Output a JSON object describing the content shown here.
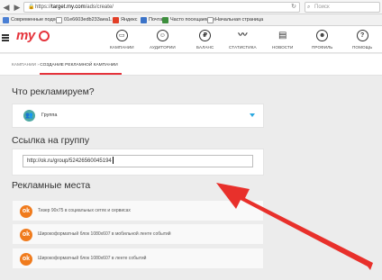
{
  "browser": {
    "address_prefix": "https://",
    "address_host": "target.my.com",
    "address_path": "/ads/create/",
    "search_placeholder": "Поиск",
    "bookmarks": [
      {
        "label": "Современные подхо...",
        "color": "#4a7fd4"
      },
      {
        "label": "01e6603edb233aea1...",
        "color": "#d9d9d9"
      },
      {
        "label": "Яндекс",
        "color": "#e23f27"
      },
      {
        "label": "Почта",
        "color": "#3b73c8"
      },
      {
        "label": "Часто посещаемые",
        "color": "#3d8f3d"
      },
      {
        "label": "Начальная страница",
        "color": "#d9d9d9"
      }
    ]
  },
  "header": {
    "logo_text": "my",
    "nav": [
      {
        "label": "КАМПАНИИ",
        "icon": "megaphone-icon",
        "glyph": "▭"
      },
      {
        "label": "АУДИТОРИИ",
        "icon": "audience-icon",
        "glyph": "☺"
      },
      {
        "label": "БАЛАНС",
        "icon": "ruble-icon",
        "glyph": "₽"
      },
      {
        "label": "СТАТИСТИКА",
        "icon": "chart-icon",
        "glyph": "〰"
      },
      {
        "label": "НОВОСТИ",
        "icon": "news-icon",
        "glyph": "▤"
      },
      {
        "label": "ПРОФИЛЬ",
        "icon": "profile-icon",
        "glyph": "☻"
      },
      {
        "label": "ПОМОЩЬ",
        "icon": "help-icon",
        "glyph": "?"
      }
    ]
  },
  "breadcrumb": {
    "parent": "КАМПАНИИ",
    "separator": "›",
    "current": "СОЗДАНИЕ РЕКЛАМНОЙ КАМПАНИИ"
  },
  "sections": {
    "what_title": "Что рекламируем?",
    "what_selected": "Группа",
    "link_title": "Ссылка на группу",
    "link_value": "http://ok.ru/group/52426560045194",
    "places_title": "Рекламные места"
  },
  "places": [
    {
      "label": "Тизер 90x75 в социальных сетях и сервисах"
    },
    {
      "label": "Широкоформатный блок 1080x607 в мобильной ленте событий"
    },
    {
      "label": "Широкоформатный блок 1080x607 в ленте событий"
    }
  ],
  "colors": {
    "accent": "#e5333b",
    "ok_orange": "#f07b1d",
    "group_teal": "#4ea9a3",
    "caret_blue": "#2aa8e0",
    "annotation_arrow": "#e8302b"
  }
}
